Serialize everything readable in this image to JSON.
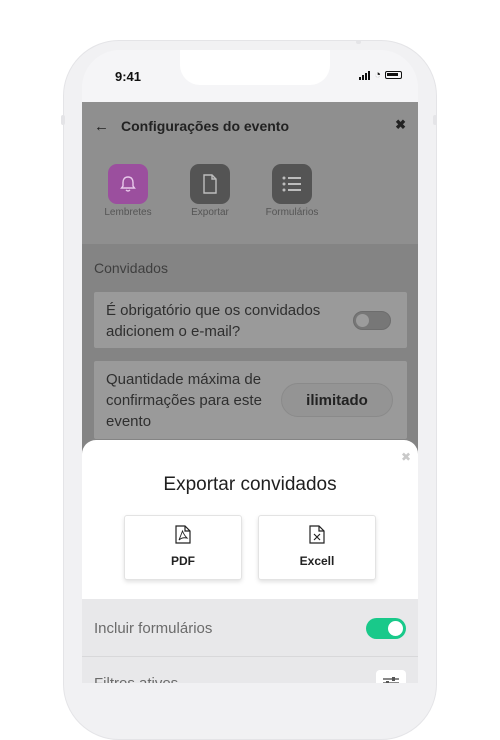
{
  "status_bar": {
    "time": "9:41"
  },
  "header": {
    "title": "Configurações do evento",
    "back_icon": "arrow-left-icon",
    "close_icon": "close-icon"
  },
  "tabs": [
    {
      "label": "Lembretes",
      "icon": "bell-icon",
      "color": "#9b4f9e"
    },
    {
      "label": "Exportar",
      "icon": "document-icon",
      "color": "#545454"
    },
    {
      "label": "Formulários",
      "icon": "list-icon",
      "color": "#545454"
    }
  ],
  "section": {
    "title": "Convidados"
  },
  "settings": {
    "email_required": {
      "label": "É obrigatório que os convidados adicionem o e-mail?",
      "enabled": false
    },
    "max_confirmations": {
      "label": "Quantidade máxima de confirmações para este evento",
      "value": "ilimitado"
    }
  },
  "sheet": {
    "title": "Exportar convidados",
    "close_icon": "close-icon",
    "buttons": [
      {
        "label": "PDF",
        "icon": "pdf-file-icon"
      },
      {
        "label": "Excell",
        "icon": "excel-file-icon"
      }
    ],
    "options": {
      "include_forms": {
        "label": "Incluir formulários",
        "enabled": true
      },
      "active_filters": {
        "label": "Filtros ativos",
        "icon": "sliders-icon"
      }
    }
  },
  "colors": {
    "accent": "#19c98a",
    "reminder_tab": "#9b4f9e"
  }
}
